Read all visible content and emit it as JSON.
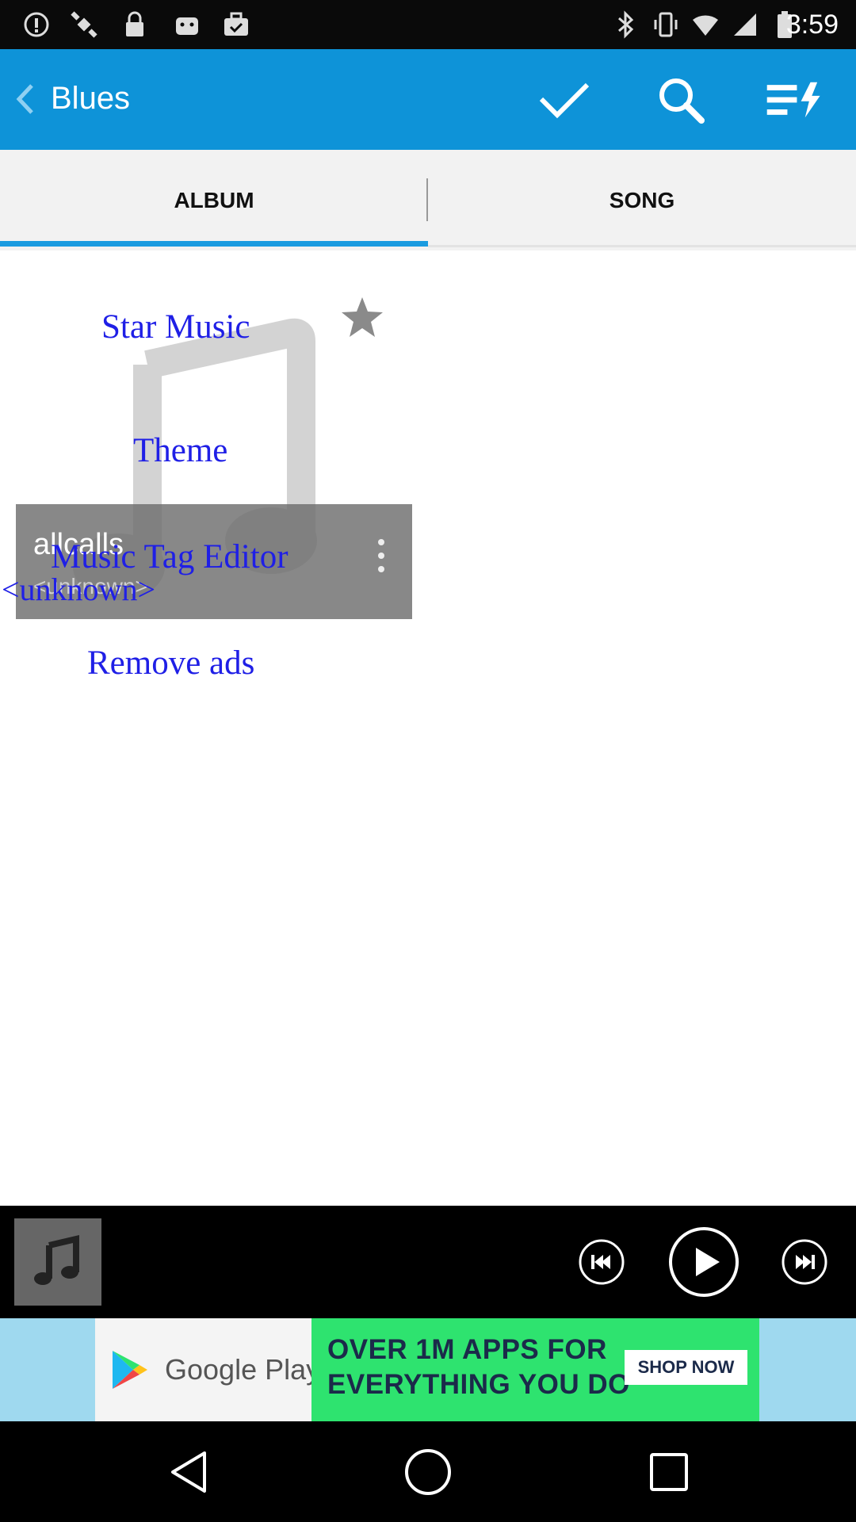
{
  "status_bar": {
    "time": "3:59",
    "left_icons": [
      "info-icon",
      "satellite-icon",
      "lock-icon",
      "android-icon",
      "briefcase-check-icon"
    ],
    "right_icons": [
      "bluetooth-icon",
      "vibrate-icon",
      "wifi-icon",
      "signal-icon",
      "battery-icon"
    ]
  },
  "action_bar": {
    "title": "Blues",
    "color": "#0e93d8"
  },
  "tabs": [
    {
      "label": "ALBUM",
      "selected": true
    },
    {
      "label": "SONG",
      "selected": false
    }
  ],
  "album": {
    "name": "allcalls",
    "artist": "<unknown>"
  },
  "overlay_menu": {
    "items": [
      "Star Music",
      "Theme",
      "Music Tag Editor",
      "<unknown>",
      "Remove ads"
    ],
    "color": "#1f1fe6"
  },
  "ad": {
    "brand": "Google Play",
    "headline_line1": "OVER 1M APPS FOR",
    "headline_line2": "EVERYTHING YOU DO",
    "cta": "SHOP NOW"
  }
}
